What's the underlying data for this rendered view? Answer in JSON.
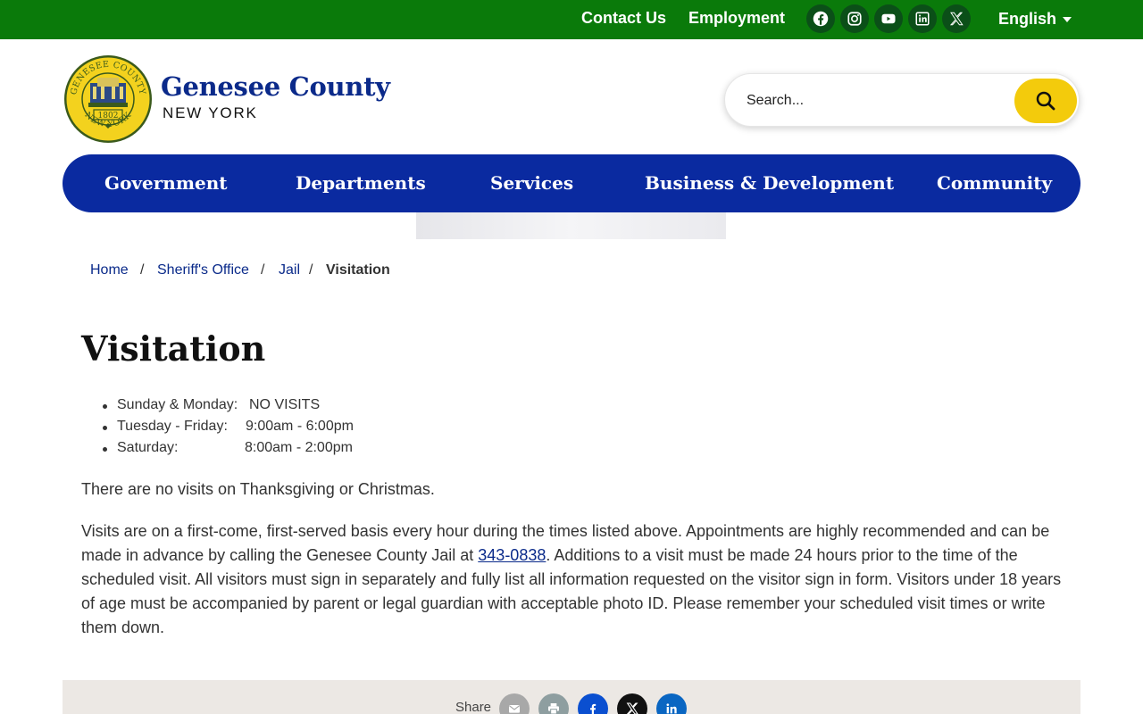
{
  "topbar": {
    "contact_label": "Contact Us",
    "employment_label": "Employment",
    "social": [
      "facebook-icon",
      "instagram-icon",
      "youtube-icon",
      "linkedin-icon",
      "x-icon"
    ],
    "language": "English",
    "bg_color": "#0a7a0a"
  },
  "header": {
    "seal": {
      "top_text": "GENESEE COUNTY",
      "bottom_text": "NEW YORK",
      "year": "1802"
    },
    "brand_name": "Genesee County",
    "brand_sub": "NEW YORK"
  },
  "search": {
    "placeholder": "Search..."
  },
  "nav": {
    "items": [
      "Government",
      "Departments",
      "Services",
      "Business & Development",
      "Community"
    ],
    "color": "#0a2aa0"
  },
  "breadcrumb": {
    "items": [
      "Home",
      "Sheriff's Office",
      "Jail"
    ],
    "current": "Visitation"
  },
  "content": {
    "title": "Visitation",
    "hours": [
      {
        "day": "Sunday & Monday:",
        "time": "NO VISITS"
      },
      {
        "day": "Tuesday - Friday:",
        "time": "9:00am - 6:00pm"
      },
      {
        "day": "Saturday:",
        "time": "8:00am - 2:00pm"
      }
    ],
    "holiday_note": "There are no visits on Thanksgiving or Christmas.",
    "policy_before_phone": "Visits are on a first-come, first-served basis every hour during the times listed above. Appointments are highly recommended and can be made in advance by calling the Genesee County Jail at ",
    "phone": "343-0838",
    "policy_after_phone": ".  Additions to a visit must be made 24 hours prior to the time of the scheduled visit.  All visitors must sign in separately and fully list all information requested on the visitor sign in form.  Visitors under 18 years of age must be accompanied by parent or legal guardian with acceptable photo ID.  Please remember your scheduled visit times or write them down."
  },
  "share": {
    "label": "Share",
    "buttons": [
      "email-icon",
      "print-icon",
      "facebook-icon",
      "x-icon",
      "linkedin-icon"
    ]
  }
}
